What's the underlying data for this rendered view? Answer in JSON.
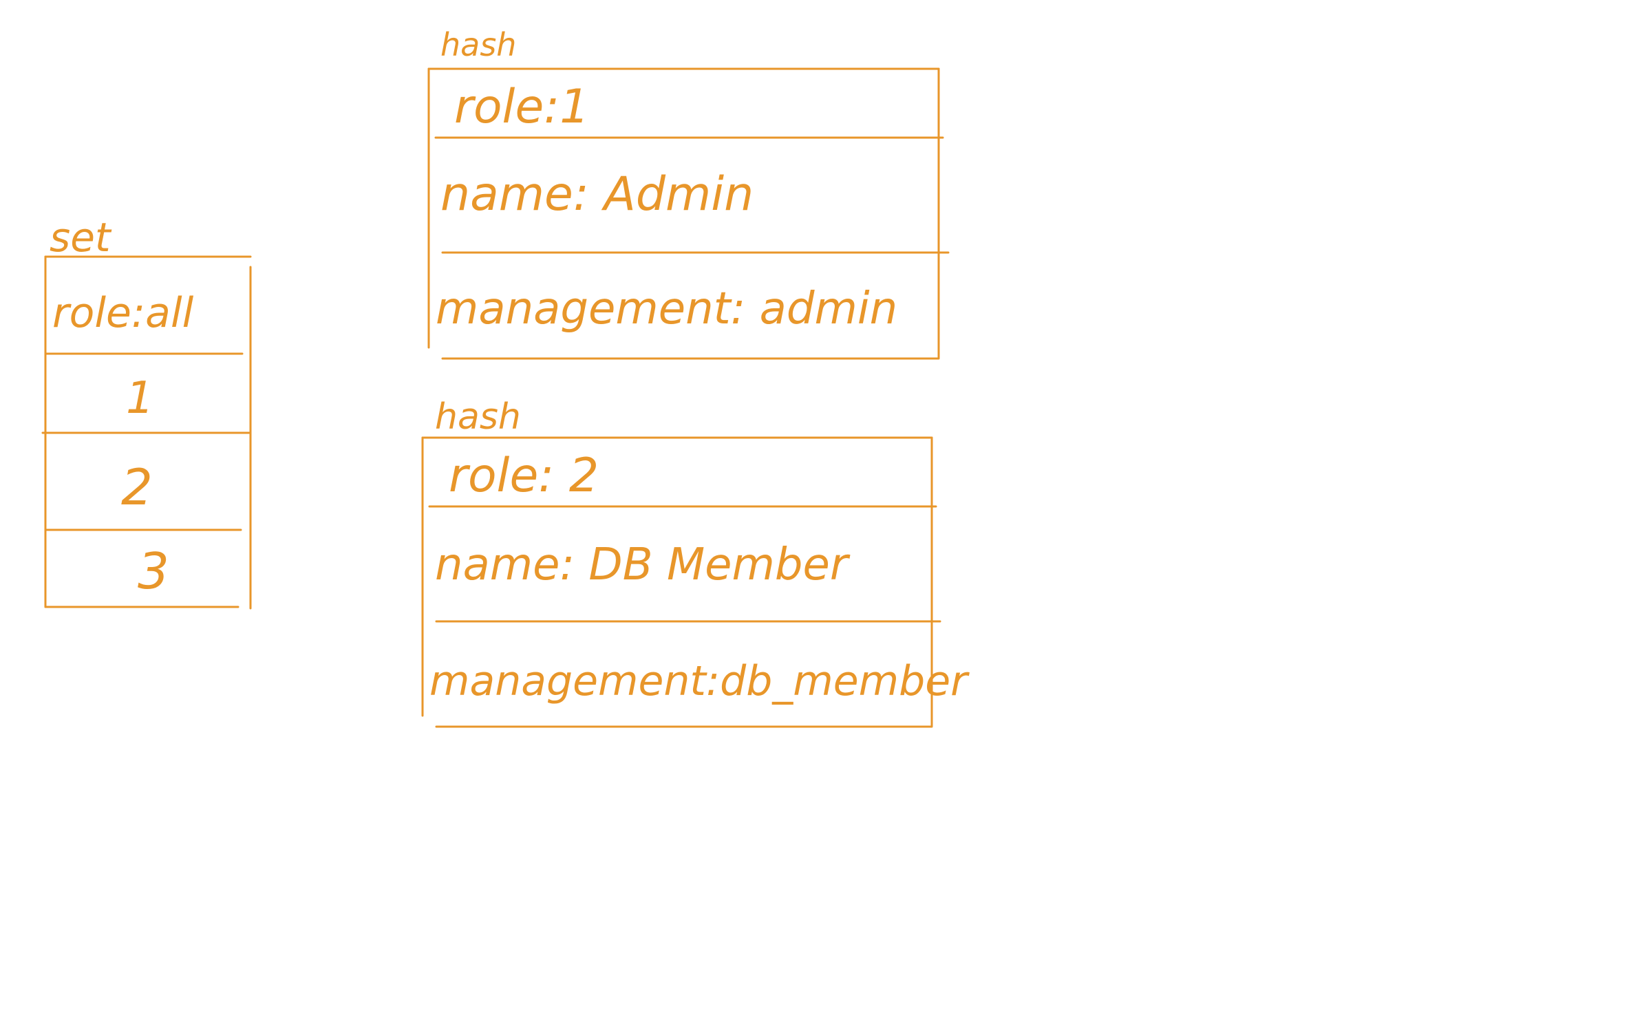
{
  "ink_color": "#E8962A",
  "set_box": {
    "label": "set",
    "rows": [
      "role:all",
      "1",
      "2",
      "3"
    ]
  },
  "hash_boxes": [
    {
      "label": "hash",
      "rows": [
        "role:1",
        "name: Admin",
        "management: admin"
      ]
    },
    {
      "label": "hash",
      "rows": [
        "role: 2",
        "name: DB  Member",
        "management:db_member"
      ]
    }
  ]
}
